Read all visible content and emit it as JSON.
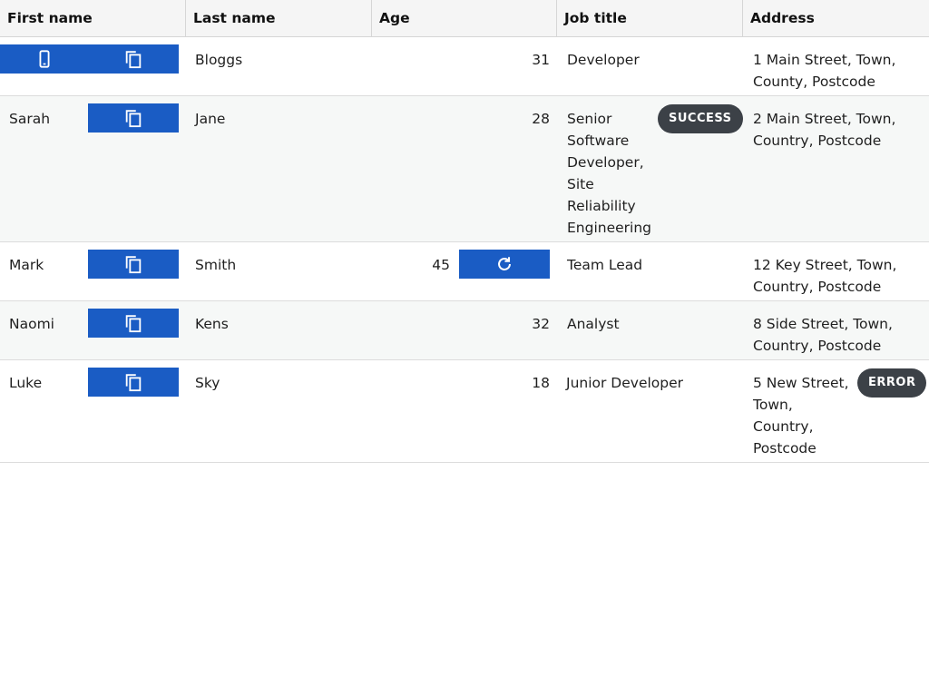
{
  "columns": {
    "first_name": "First name",
    "last_name": "Last name",
    "age": "Age",
    "job_title": "Job title",
    "address": "Address"
  },
  "rows": [
    {
      "first_name": "",
      "last_name": "Bloggs",
      "age": "31",
      "job_title": "Developer",
      "address_lines": [
        "1 Main Street, Town,",
        "County, Postcode"
      ]
    },
    {
      "first_name": "Sarah",
      "last_name": "Jane",
      "age": "28",
      "job_title_lines": [
        "Senior",
        "Software",
        "Developer,",
        "Site",
        "Reliability",
        "Engineering"
      ],
      "badge": "SUCCESS",
      "address_lines": [
        "2 Main Street, Town,",
        "Country, Postcode"
      ]
    },
    {
      "first_name": "Mark",
      "last_name": "Smith",
      "age": "45",
      "job_title": "Team Lead",
      "address_lines": [
        "12 Key Street, Town,",
        "Country, Postcode"
      ]
    },
    {
      "first_name": "Naomi",
      "last_name": "Kens",
      "age": "32",
      "job_title": "Analyst",
      "address_lines": [
        "8 Side Street, Town,",
        "Country, Postcode"
      ]
    },
    {
      "first_name": "Luke",
      "last_name": "Sky",
      "age": "18",
      "job_title": "Junior Developer",
      "badge": "ERROR",
      "address_lines": [
        "5 New Street,",
        "Town,",
        "Country,",
        "Postcode"
      ]
    }
  ],
  "colors": {
    "button": "#1a5cc4",
    "badge": "#3c4147",
    "header_bg": "#f5f5f5",
    "alt_row_bg": "#f6f8f7"
  },
  "icons": {
    "row1_first_button": "mobile-icon",
    "copy_button": "copy-icon",
    "refresh_button": "refresh-icon"
  }
}
